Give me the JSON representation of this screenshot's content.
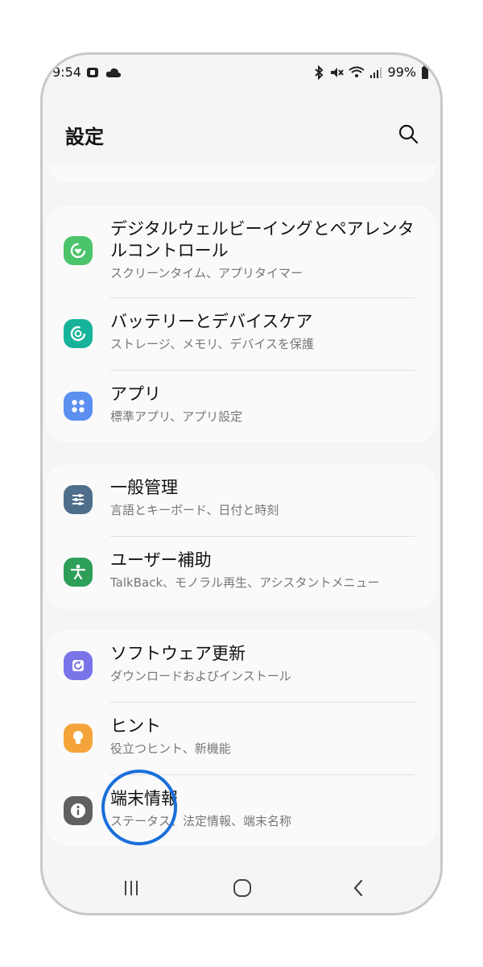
{
  "status": {
    "time": "9:54",
    "battery": "99%"
  },
  "header": {
    "title": "設定"
  },
  "groups": [
    {
      "items": [
        {
          "title": "デジタルウェルビーイングとペアレンタルコントロール",
          "subtitle": "スクリーンタイム、アプリタイマー",
          "icon": "digital-wellbeing-icon",
          "color": "#4cc46b"
        },
        {
          "title": "バッテリーとデバイスケア",
          "subtitle": "ストレージ、メモリ、デバイスを保護",
          "icon": "device-care-icon",
          "color": "#16b39a"
        },
        {
          "title": "アプリ",
          "subtitle": "標準アプリ、アプリ設定",
          "icon": "apps-icon",
          "color": "#5b8ff0"
        }
      ]
    },
    {
      "items": [
        {
          "title": "一般管理",
          "subtitle": "言語とキーボード、日付と時刻",
          "icon": "general-management-icon",
          "color": "#4e6e8c"
        },
        {
          "title": "ユーザー補助",
          "subtitle": "TalkBack、モノラル再生、アシスタントメニュー",
          "icon": "accessibility-icon",
          "color": "#2e9f58"
        }
      ]
    },
    {
      "items": [
        {
          "title": "ソフトウェア更新",
          "subtitle": "ダウンロードおよびインストール",
          "icon": "software-update-icon",
          "color": "#7a74e8"
        },
        {
          "title": "ヒント",
          "subtitle": "役立つヒント、新機能",
          "icon": "tips-icon",
          "color": "#f5a43c"
        },
        {
          "title": "端末情報",
          "subtitle": "ステータス、法定情報、端末名称",
          "icon": "info-icon",
          "color": "#616161"
        }
      ]
    }
  ],
  "colors": {
    "highlight": "#1a6fdb"
  }
}
